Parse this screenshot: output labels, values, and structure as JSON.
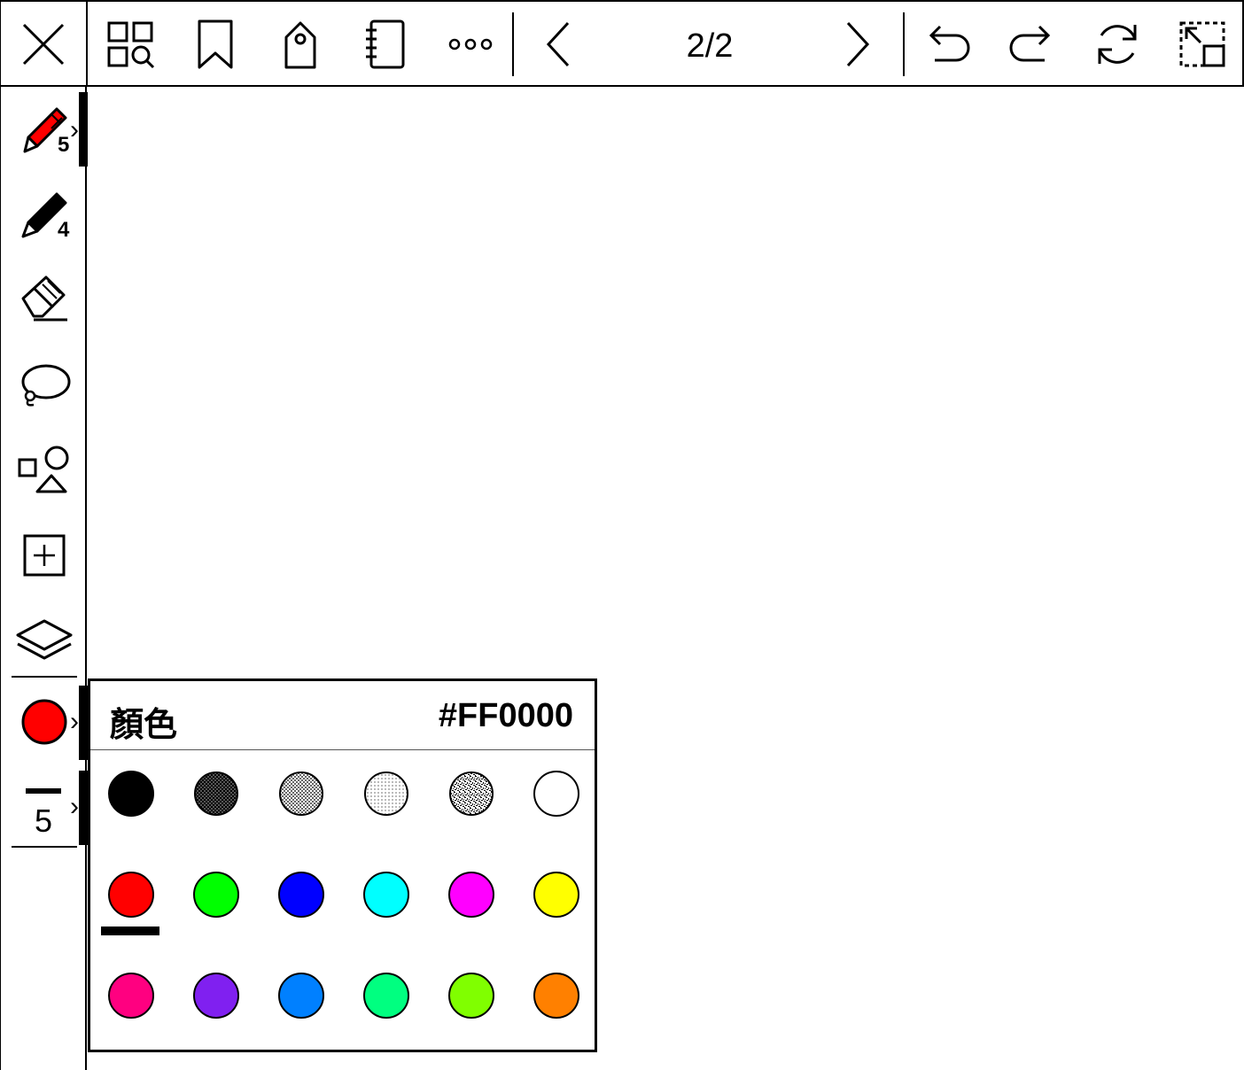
{
  "toolbar": {
    "page_indicator": "2/2",
    "icons": [
      "close-icon",
      "thumbnail-search-icon",
      "bookmark-icon",
      "tag-icon",
      "notebook-icon",
      "more-icon",
      "chevron-left-icon",
      "chevron-right-icon",
      "undo-icon",
      "redo-icon",
      "sync-icon",
      "resize-icon"
    ]
  },
  "sidebar": {
    "pen_width_1": "5",
    "pen_width_2": "4",
    "line_width": "5",
    "current_color": "#FF0000",
    "icons": [
      "marker-icon",
      "pencil-icon",
      "eraser-icon",
      "lasso-icon",
      "shapes-icon",
      "insert-icon",
      "layers-icon"
    ]
  },
  "color_popup": {
    "title": "顏色",
    "hex_value": "#FF0000",
    "selected": "#FF0000",
    "rows": [
      [
        "#000000",
        "gray-dark",
        "gray-medium",
        "gray-light",
        "gray-noise",
        "#FFFFFF"
      ],
      [
        "#FF0000",
        "#00FF00",
        "#0000FF",
        "#00FFFF",
        "#FF00FF",
        "#FFFF00"
      ],
      [
        "#FF0080",
        "#8020F0",
        "#0080FF",
        "#00FF80",
        "#80FF00",
        "#FF8000"
      ]
    ]
  }
}
